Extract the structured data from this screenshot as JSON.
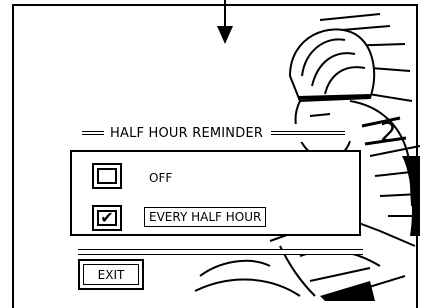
{
  "dialog": {
    "title": "HALF HOUR REMINDER",
    "options": [
      {
        "label": "OFF",
        "checked": false
      },
      {
        "label": "EVERY HALF HOUR",
        "checked": true
      }
    ],
    "check_glyph": "✔"
  },
  "footer": {
    "exit_label": "EXIT"
  },
  "icons": {
    "arrow": "down-arrow-icon",
    "cyclist": "cyclist-illustration"
  },
  "colors": {
    "ink": "#000000",
    "paper": "#ffffff"
  }
}
